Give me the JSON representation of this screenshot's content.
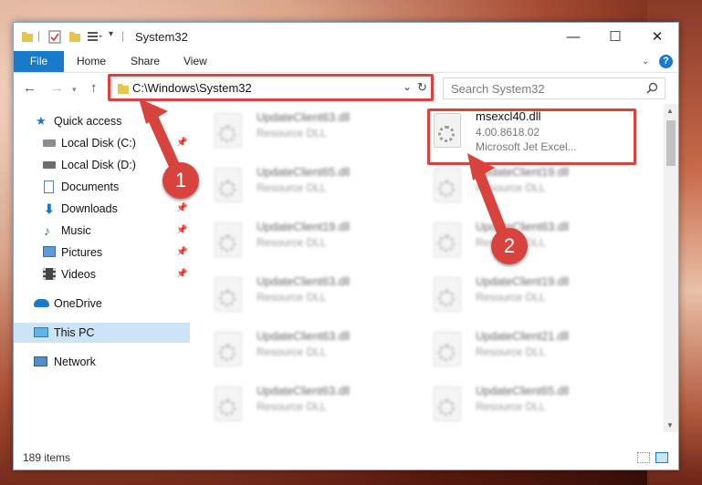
{
  "window": {
    "title": "System32",
    "controls": {
      "minimize": "—",
      "maximize": "☐",
      "close": "✕"
    }
  },
  "ribbon": {
    "file": "File",
    "tabs": [
      "Home",
      "Share",
      "View"
    ],
    "help": "?"
  },
  "navigation": {
    "back": "←",
    "forward": "→",
    "up": "↑",
    "address": "C:\\Windows\\System32",
    "refresh": "↻",
    "search_placeholder": "Search System32"
  },
  "sidebar": {
    "items": [
      {
        "label": "Quick access",
        "icon": "star-icon",
        "pinned": false
      },
      {
        "label": "Local Disk (C:)",
        "icon": "drive-icon",
        "pinned": true
      },
      {
        "label": "Local Disk (D:)",
        "icon": "drive-icon",
        "pinned": false
      },
      {
        "label": "Documents",
        "icon": "documents-icon",
        "pinned": true
      },
      {
        "label": "Downloads",
        "icon": "download-icon",
        "pinned": true
      },
      {
        "label": "Music",
        "icon": "music-icon",
        "pinned": true
      },
      {
        "label": "Pictures",
        "icon": "pictures-icon",
        "pinned": true
      },
      {
        "label": "Videos",
        "icon": "videos-icon",
        "pinned": true
      },
      {
        "label": "OneDrive",
        "icon": "cloud-icon",
        "pinned": false
      },
      {
        "label": "This PC",
        "icon": "computer-icon",
        "pinned": false,
        "selected": true
      },
      {
        "label": "Network",
        "icon": "network-icon",
        "pinned": false
      }
    ]
  },
  "files": {
    "highlighted": {
      "name": "msexcl40.dll",
      "version": "4.00.8618.02",
      "description": "Microsoft Jet Excel..."
    },
    "left_column": [
      {
        "name": "UpdateClient63.dll",
        "desc": "Resource DLL"
      },
      {
        "name": "UpdateClient65.dll",
        "desc": "Resource DLL"
      },
      {
        "name": "UpdateClient19.dll",
        "desc": "Resource DLL"
      },
      {
        "name": "UpdateClient63.dll",
        "desc": "Resource DLL"
      },
      {
        "name": "UpdateClient63.dll",
        "desc": "Resource DLL"
      },
      {
        "name": "UpdateClient63.dll",
        "desc": "Resource DLL"
      }
    ],
    "right_column": [
      {
        "name": "UpdateClient19.dll",
        "desc": "Resource DLL"
      },
      {
        "name": "UpdateClient63.dll",
        "desc": "Resource DLL"
      },
      {
        "name": "UpdateClient19.dll",
        "desc": "Resource DLL"
      },
      {
        "name": "UpdateClient21.dll",
        "desc": "Resource DLL"
      },
      {
        "name": "UpdateClient65.dll",
        "desc": "Resource DLL"
      }
    ]
  },
  "status": {
    "count": "189 items"
  },
  "annotations": {
    "marker1": "1",
    "marker2": "2",
    "color": "#d9433d"
  }
}
